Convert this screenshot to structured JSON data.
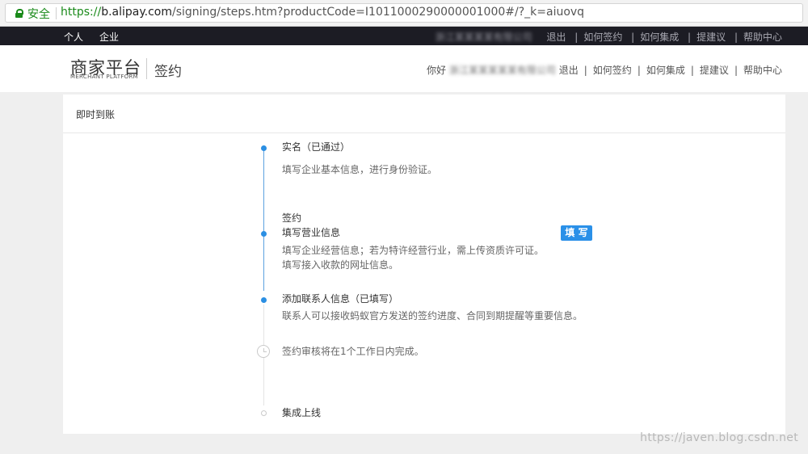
{
  "browser": {
    "secure_label": "安全",
    "url_scheme": "https://",
    "url_host": "b.alipay.com",
    "url_path": "/signing/steps.htm?productCode=I1011000290000001000#/?_k=aiuovq"
  },
  "topbar": {
    "left_links": [
      "个人",
      "企业"
    ],
    "company_blurred": "浙江某某某某有限公司",
    "links": [
      "退出",
      "如何签约",
      "如何集成",
      "提建议",
      "帮助中心"
    ]
  },
  "header": {
    "logo_cn": "商家平台",
    "logo_en": "MERCHANT PLATFORM",
    "page_title": "签约",
    "greeting": "你好",
    "company_blurred": "浙江某某某某某有限公司",
    "links": [
      "退出",
      "如何签约",
      "如何集成",
      "提建议",
      "帮助中心"
    ]
  },
  "card": {
    "title": "即时到账",
    "steps": {
      "realname_title": "实名",
      "realname_status": "（已通过）",
      "realname_desc": "填写企业基本信息，进行身份验证。",
      "sign_label": "签约",
      "business_title": "填写营业信息",
      "business_desc_1a": "填写企业经营信息；若为特许经营行业，需上传",
      "business_desc_1b": "资质许可证",
      "business_desc_1c": "。",
      "business_desc_2": "填写接入收款的网址信息。",
      "fill_button": "填 写",
      "contact_title": "添加联系人信息",
      "contact_status": "（已填写）",
      "contact_desc": "联系人可以接收蚂蚁官方发送的签约进度、合同到期提醒等重要信息。",
      "review_text": "签约审核将在1个工作日内完成。",
      "online_title": "集成上线"
    }
  },
  "watermark": "https://javen.blog.csdn.net"
}
